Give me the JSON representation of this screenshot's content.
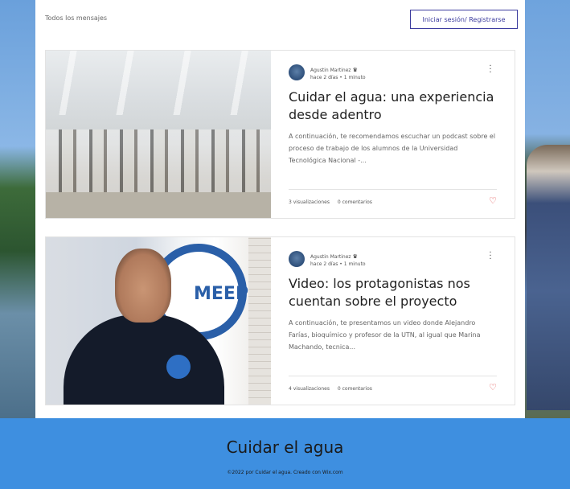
{
  "header": {
    "all_posts": "Todos los mensajes",
    "login_label": "Iniciar sesión/ Registrarse"
  },
  "posts": [
    {
      "author": "Agustin Martinez",
      "meta": "hace 2 días  •  1 minuto",
      "title": "Cuidar el agua: una experiencia desde adentro",
      "excerpt": "A continuación, te recomendamos escuchar un podcast sobre el proceso de trabajo de los alumnos de la Universidad Tecnológica Nacional -...",
      "views": "3 visualizaciones",
      "comments": "0 comentarios"
    },
    {
      "author": "Agustin Martinez",
      "meta": "hace 2 días  •  1 minuto",
      "title": "Video: los protagonistas nos cuentan sobre el proyecto",
      "excerpt": "A continuación, te presentamos un video donde Alejandro Farías, bioquímico y profesor de la UTN, al igual que Marina Machando, tecnica...",
      "views": "4 visualizaciones",
      "comments": "0 comentarios",
      "image_text": "MEEP"
    }
  ],
  "footer": {
    "site_title": "Cuidar el agua",
    "credit": "©2022 por Cuidar el agua. Creado con Wix.com"
  },
  "icons": {
    "crown": "crown-icon",
    "more": "more-vertical-icon",
    "heart": "heart-icon"
  },
  "colors": {
    "accent": "#3b3b9e",
    "footer_bg": "#3e8fe0",
    "heart": "#e04848"
  }
}
